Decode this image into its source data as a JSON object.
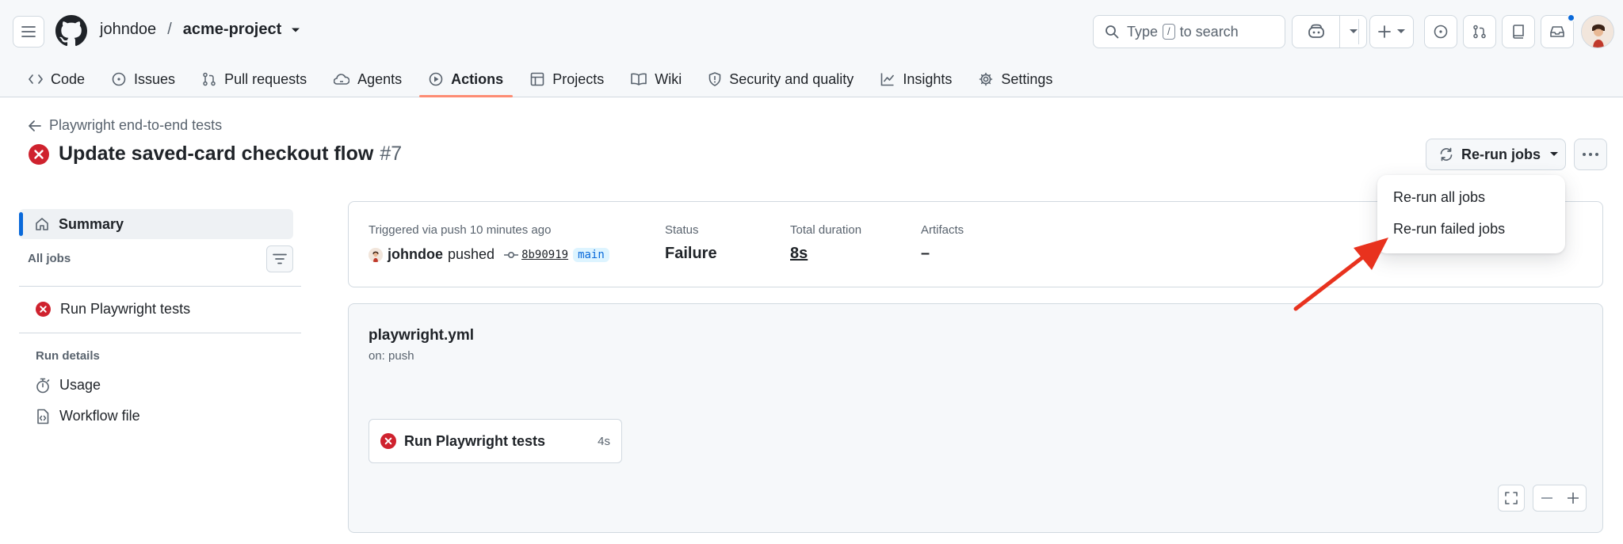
{
  "header": {
    "owner": "johndoe",
    "separator": "/",
    "repo": "acme-project",
    "search_prefix": "Type",
    "search_key": "/",
    "search_suffix": "to search"
  },
  "repo_nav": [
    {
      "label": "Code",
      "icon": "code-icon"
    },
    {
      "label": "Issues",
      "icon": "issue-icon"
    },
    {
      "label": "Pull requests",
      "icon": "pull-request-icon"
    },
    {
      "label": "Agents",
      "icon": "agent-icon"
    },
    {
      "label": "Actions",
      "icon": "play-icon",
      "active": true
    },
    {
      "label": "Projects",
      "icon": "table-icon"
    },
    {
      "label": "Wiki",
      "icon": "book-icon"
    },
    {
      "label": "Security and quality",
      "icon": "shield-icon"
    },
    {
      "label": "Insights",
      "icon": "graph-icon"
    },
    {
      "label": "Settings",
      "icon": "gear-icon"
    }
  ],
  "page": {
    "back_link": "Playwright end-to-end tests",
    "title": "Update saved-card checkout flow",
    "run_number": "#7",
    "rerun_button": "Re-run jobs"
  },
  "menu": {
    "items": [
      "Re-run all jobs",
      "Re-run failed jobs"
    ]
  },
  "sidebar": {
    "summary": "Summary",
    "all_jobs": "All jobs",
    "job": "Run Playwright tests",
    "run_details": "Run details",
    "usage": "Usage",
    "workflow_file": "Workflow file"
  },
  "summary": {
    "triggered": "Triggered via push 10 minutes ago",
    "actor": "johndoe",
    "action": "pushed",
    "sha": "8b90919",
    "branch": "main",
    "status_label": "Status",
    "status_value": "Failure",
    "duration_label": "Total duration",
    "duration_value": "8s",
    "artifacts_label": "Artifacts",
    "artifacts_value": "–"
  },
  "workflow": {
    "file": "playwright.yml",
    "trigger": "on: push",
    "job_name": "Run Playwright tests",
    "job_duration": "4s"
  },
  "colors": {
    "failure": "#cf222e",
    "accent": "#0969da",
    "active_tab_underline": "#fd8c73",
    "annotation_arrow": "#e8321e"
  }
}
